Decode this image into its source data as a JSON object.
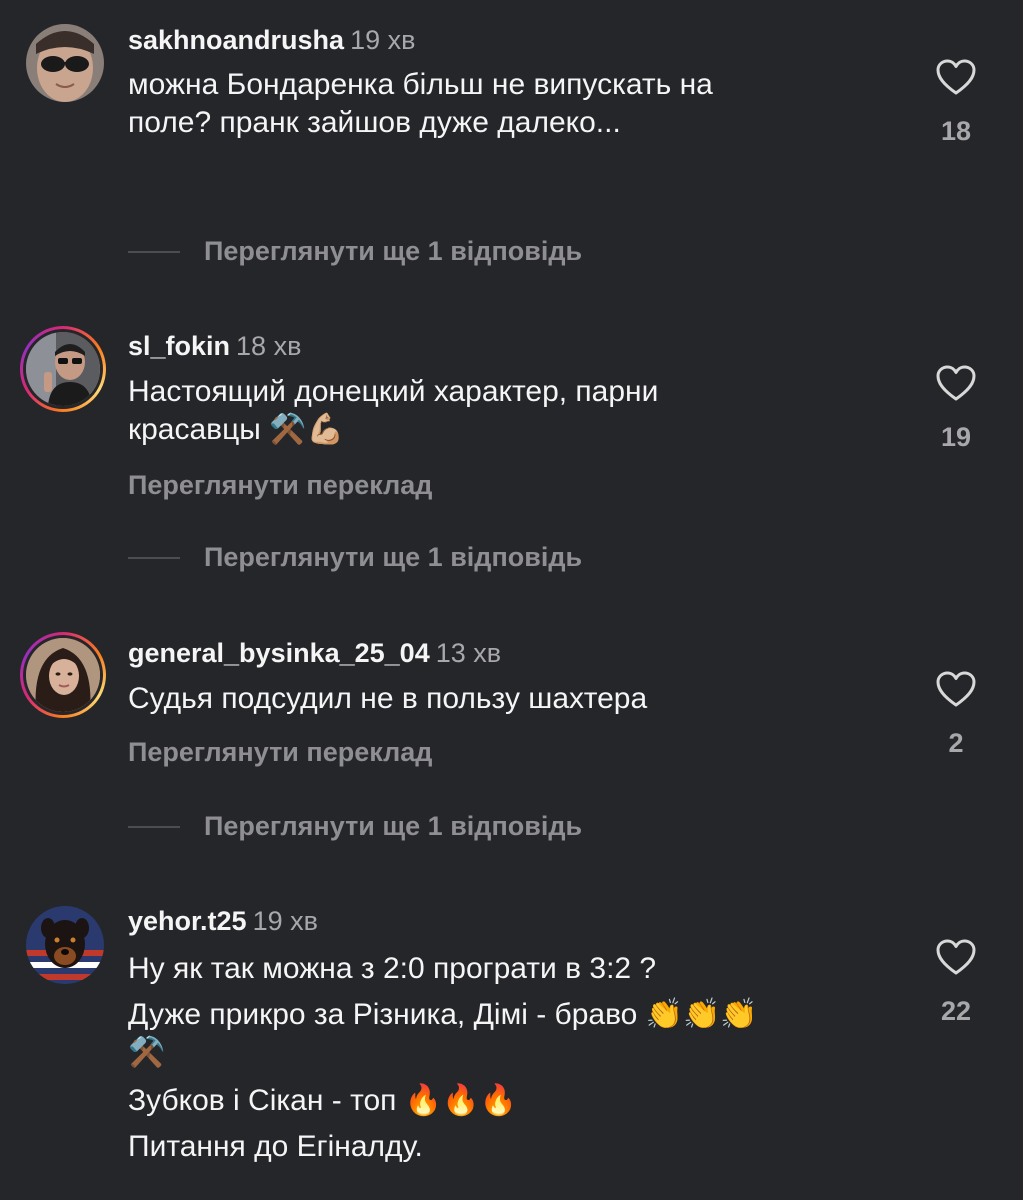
{
  "comments": [
    {
      "username": "sakhnoandrusha",
      "time": "19 хв",
      "lines": [
        "можна Бондаренка більш не випускать на",
        "поле? пранк зайшов дуже далеко..."
      ],
      "likes": "18",
      "replies_label": "Переглянути ще 1 відповідь",
      "avatar_icon": "avatar-sunglasses-man",
      "story_ring": false
    },
    {
      "username": "sl_fokin",
      "time": "18 хв",
      "lines": [
        "Настоящий донецкий характер, парни",
        "красавцы ⚒️💪🏼"
      ],
      "translate_label": "Переглянути переклад",
      "likes": "19",
      "replies_label": "Переглянути ще 1 відповідь",
      "avatar_icon": "avatar-man-sunglasses-selfie",
      "story_ring": true
    },
    {
      "username": "general_bysinka_25_04",
      "time": "13 хв",
      "lines": [
        "Судья подсудил не в пользу шахтера"
      ],
      "translate_label": "Переглянути переклад",
      "likes": "2",
      "replies_label": "Переглянути ще 1 відповідь",
      "avatar_icon": "avatar-woman-dark-hair",
      "story_ring": true
    },
    {
      "username": "yehor.t25",
      "time": "19 хв",
      "lines": [
        "Ну як так можна з 2:0 програти в 3:2 ?",
        "Дуже прикро за Різника, Дімі - браво 👏👏👏",
        "⚒️",
        "Зубков і Сікан - топ 🔥🔥🔥",
        "Питання до Егіналду."
      ],
      "likes": "22",
      "avatar_icon": "avatar-rottweiler-flag",
      "story_ring": false
    }
  ],
  "colors": {
    "background": "#25262a",
    "text": "#f5f5f5",
    "secondary": "#a8a8ab",
    "link": "#8e8e93",
    "story_ring": [
      "#d62976",
      "#fa7e1e",
      "#feda75",
      "#962fbf"
    ]
  },
  "icons": {
    "like": "heart-outline-icon"
  }
}
